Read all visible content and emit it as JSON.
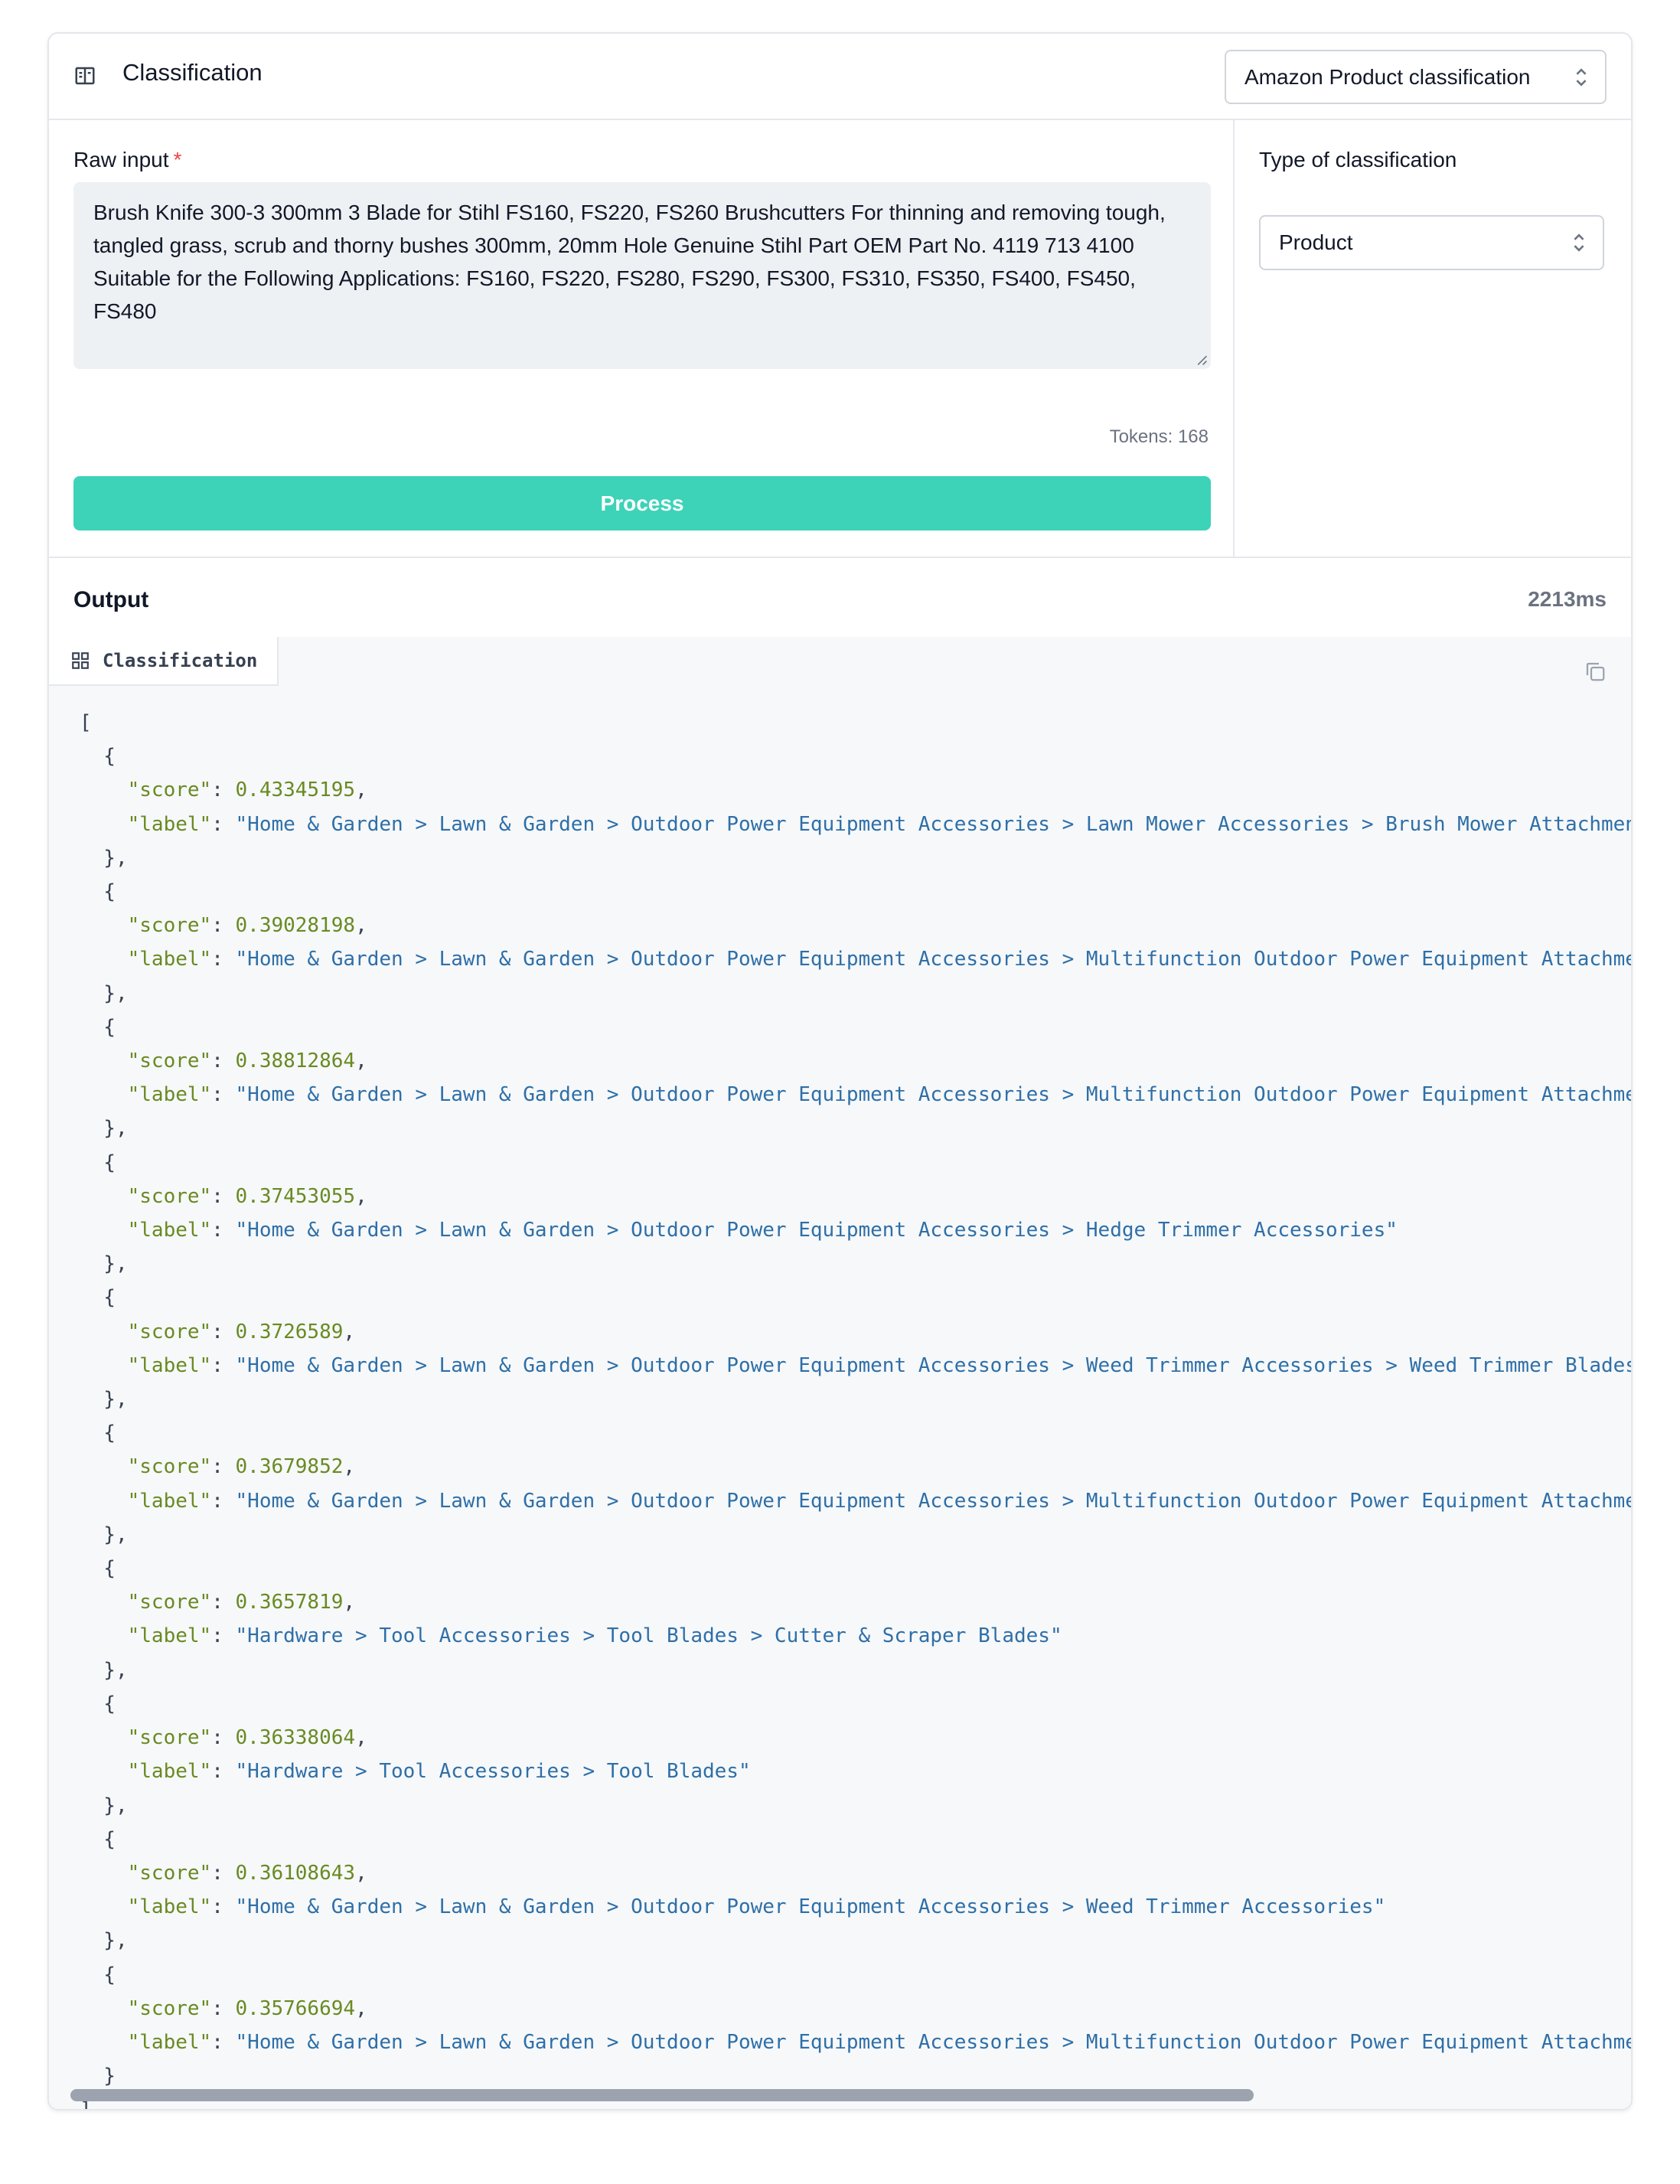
{
  "header": {
    "title": "Classification",
    "model_select": "Amazon Product classification"
  },
  "input": {
    "label": "Raw input",
    "required_mark": "*",
    "text": "Brush Knife 300-3 300mm 3 Blade for Stihl FS160, FS220, FS260 Brushcutters For thinning and removing tough, tangled grass, scrub and thorny bushes 300mm, 20mm Hole Genuine Stihl Part OEM Part No. 4119 713 4100 Suitable for the Following Applications: FS160, FS220, FS280, FS290, FS300, FS310, FS350, FS400, FS450, FS480",
    "tokens": "Tokens: 168",
    "process_label": "Process"
  },
  "side": {
    "type_label": "Type of classification",
    "type_select": "Product"
  },
  "output": {
    "title": "Output",
    "timing": "2213ms",
    "tab_label": "Classification",
    "results": [
      {
        "score": "0.43345195",
        "label": "Home & Garden > Lawn & Garden > Outdoor Power Equipment Accessories > Lawn Mower Accessories > Brush Mower Attachmen"
      },
      {
        "score": "0.39028198",
        "label": "Home & Garden > Lawn & Garden > Outdoor Power Equipment Accessories > Multifunction Outdoor Power Equipment Attachme"
      },
      {
        "score": "0.38812864",
        "label": "Home & Garden > Lawn & Garden > Outdoor Power Equipment Accessories > Multifunction Outdoor Power Equipment Attachme"
      },
      {
        "score": "0.37453055",
        "label": "Home & Garden > Lawn & Garden > Outdoor Power Equipment Accessories > Hedge Trimmer Accessories",
        "closed": true
      },
      {
        "score": "0.3726589",
        "label": "Home & Garden > Lawn & Garden > Outdoor Power Equipment Accessories > Weed Trimmer Accessories > Weed Trimmer Blades"
      },
      {
        "score": "0.3679852",
        "label": "Home & Garden > Lawn & Garden > Outdoor Power Equipment Accessories > Multifunction Outdoor Power Equipment Attachme"
      },
      {
        "score": "0.3657819",
        "label": "Hardware > Tool Accessories > Tool Blades > Cutter & Scraper Blades",
        "closed": true
      },
      {
        "score": "0.36338064",
        "label": "Hardware > Tool Accessories > Tool Blades",
        "closed": true
      },
      {
        "score": "0.36108643",
        "label": "Home & Garden > Lawn & Garden > Outdoor Power Equipment Accessories > Weed Trimmer Accessories",
        "closed": true
      },
      {
        "score": "0.35766694",
        "label": "Home & Garden > Lawn & Garden > Outdoor Power Equipment Accessories > Multifunction Outdoor Power Equipment Attachme"
      }
    ]
  },
  "colors": {
    "accent": "#3dd3b8",
    "required": "#ef4444",
    "json_string": "#2f6fa7",
    "json_number": "#6a8a22"
  },
  "icons": {
    "header": "book-icon",
    "select": "chevron-up-down-icon",
    "tab": "grid-icon",
    "copy": "copy-icon"
  }
}
